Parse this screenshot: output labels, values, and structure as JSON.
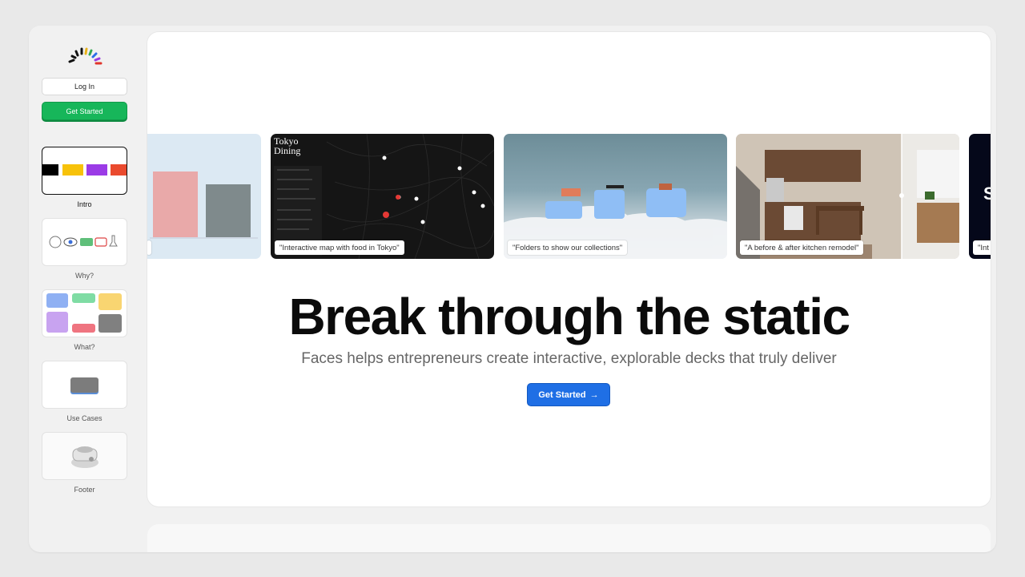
{
  "sidebar": {
    "login_label": "Log In",
    "get_started_label": "Get Started",
    "sections": [
      {
        "label": "Intro",
        "active": true
      },
      {
        "label": "Why?",
        "active": false
      },
      {
        "label": "What?",
        "active": false
      },
      {
        "label": "Use Cases",
        "active": false
      },
      {
        "label": "Footer",
        "active": false
      }
    ]
  },
  "carousel": {
    "cards": [
      {
        "caption": ""
      },
      {
        "title_line1": "Tokyo",
        "title_line2": "Dining",
        "caption": "\"Interactive map with food in Tokyo\""
      },
      {
        "caption": "\"Folders to show our collections\""
      },
      {
        "caption": "\"A before & after kitchen remodel\""
      },
      {
        "caption": "\"Int"
      }
    ]
  },
  "hero": {
    "headline": "Break through the static",
    "subheadline": "Faces helps entrepreneurs create interactive, explorable decks that truly deliver",
    "cta_label": "Get Started",
    "cta_arrow": "→"
  },
  "colors": {
    "green": "#17b65a",
    "blue": "#1f6fe5"
  }
}
